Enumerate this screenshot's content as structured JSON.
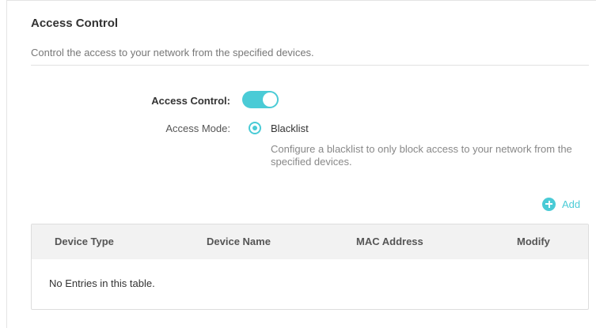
{
  "section": {
    "title": "Access Control",
    "description": "Control the access to your network from the specified devices."
  },
  "access_control": {
    "label": "Access Control:",
    "enabled": true
  },
  "access_mode": {
    "label": "Access Mode:",
    "selected": "Blacklist",
    "hint": "Configure a blacklist to only block access to your network from the specified devices."
  },
  "add_button": {
    "icon": "plus-circle-icon",
    "label": "Add"
  },
  "table": {
    "columns": [
      "Device Type",
      "Device Name",
      "MAC Address",
      "Modify"
    ],
    "empty_text": "No Entries in this table."
  },
  "colors": {
    "accent": "#4acbd6",
    "header_bg": "#f2f2f2"
  }
}
